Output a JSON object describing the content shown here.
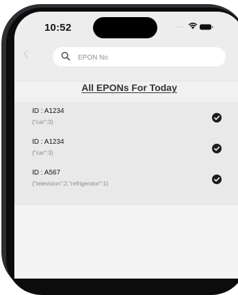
{
  "status_bar": {
    "time": "10:52",
    "signal": "...."
  },
  "search": {
    "placeholder": "EPON No",
    "value": ""
  },
  "page": {
    "title": "All EPONs For Today"
  },
  "epons": [
    {
      "id": "ID : A1234",
      "details": "{\"car\":3}",
      "checked": true
    },
    {
      "id": "ID : A1234",
      "details": "{\"car\":3}",
      "checked": true
    },
    {
      "id": "ID : A567",
      "details": "{\"television\":2,\"refrigerator\":1}",
      "checked": true
    }
  ],
  "colors": {
    "frame": "#0c0c0d",
    "screen_background": "#f1f1f1",
    "check": "#1c1c1c"
  }
}
